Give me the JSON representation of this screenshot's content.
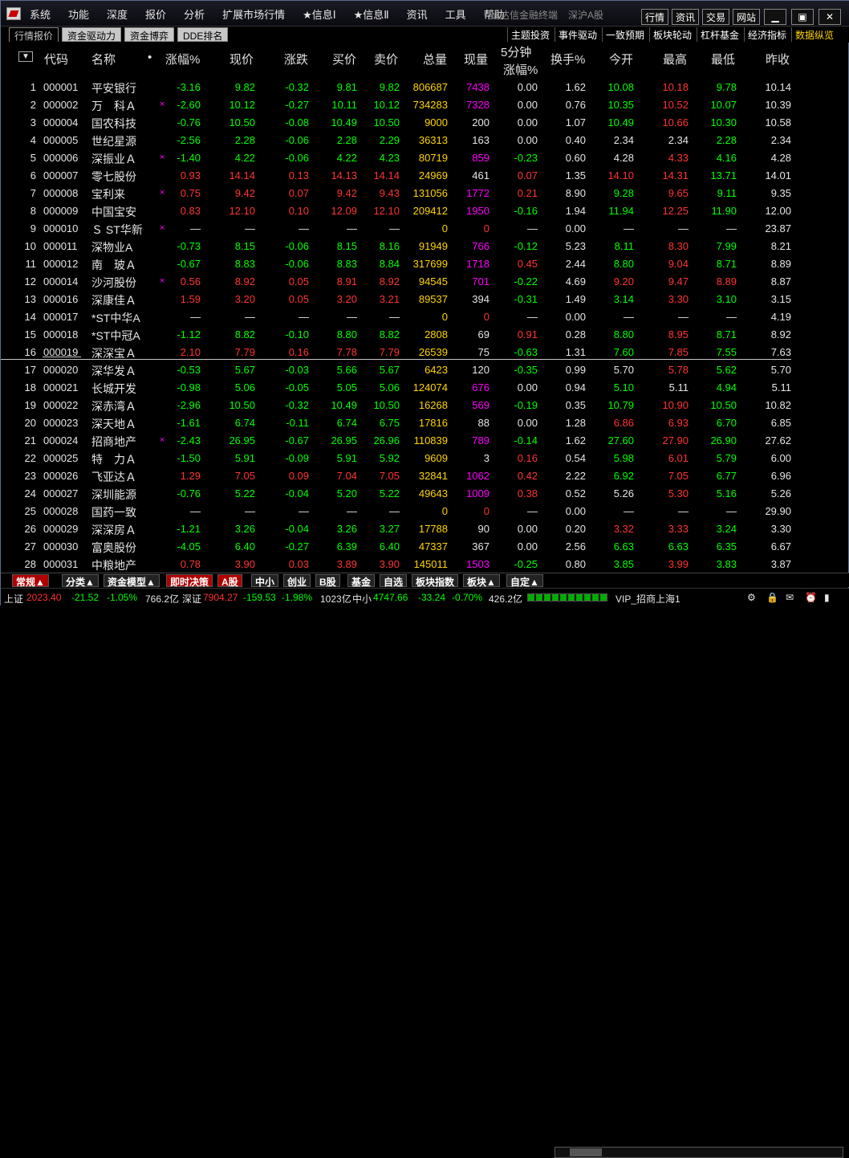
{
  "menu": [
    "系统",
    "功能",
    "深度",
    "报价",
    "分析",
    "扩展市场行情",
    "★信息Ⅰ",
    "★信息Ⅱ",
    "资讯",
    "工具",
    "帮助"
  ],
  "app_title": "通达信金融终端",
  "market_label": "深沪A股",
  "top_buttons": [
    "行情",
    "资讯",
    "交易",
    "网站"
  ],
  "window_buttons": [
    "minimize-icon",
    "restore-icon",
    "close-icon"
  ],
  "left_tabs": [
    "行情报价",
    "资金驱动力",
    "资金博弈",
    "DDE排名"
  ],
  "right_tabs": [
    "主题投资",
    "事件驱动",
    "一致预期",
    "板块轮动",
    "杠杆基金",
    "经济指标",
    "数据纵览"
  ],
  "headers": {
    "sort": "▼",
    "code": "代码",
    "name": "名称",
    "dot": "•",
    "pct": "涨幅%",
    "price": "现价",
    "chg": "涨跌",
    "bid": "买价",
    "ask": "卖价",
    "vol": "总量",
    "cur": "现量",
    "min5a": "5分钟",
    "min5b": "涨幅%",
    "turn": "换手%",
    "open": "今开",
    "high": "最高",
    "low": "最低",
    "prev": "昨收"
  },
  "rows": [
    {
      "no": "1",
      "code": "000001",
      "name": "平安银行",
      "mark": "",
      "pct": "-3.16",
      "price": "9.82",
      "chg": "-0.32",
      "bid": "9.81",
      "ask": "9.82",
      "vol": "806687",
      "cur": "7438",
      "m5": "0.00",
      "turn": "1.62",
      "open": "10.08",
      "high": "10.18",
      "low": "9.78",
      "prev": "10.14",
      "c": {
        "pct": "g",
        "price": "g",
        "chg": "g",
        "bid": "g",
        "ask": "g",
        "cur": "m",
        "m5": "w",
        "open": "g",
        "high": "rd",
        "low": "g"
      }
    },
    {
      "no": "2",
      "code": "000002",
      "name": "万　科Ａ",
      "mark": "×",
      "pct": "-2.60",
      "price": "10.12",
      "chg": "-0.27",
      "bid": "10.11",
      "ask": "10.12",
      "vol": "734283",
      "cur": "7328",
      "m5": "0.00",
      "turn": "0.76",
      "open": "10.35",
      "high": "10.52",
      "low": "10.07",
      "prev": "10.39",
      "c": {
        "pct": "g",
        "price": "g",
        "chg": "g",
        "bid": "g",
        "ask": "g",
        "cur": "m",
        "m5": "w",
        "open": "g",
        "high": "rd",
        "low": "g"
      }
    },
    {
      "no": "3",
      "code": "000004",
      "name": "国农科技",
      "mark": "",
      "pct": "-0.76",
      "price": "10.50",
      "chg": "-0.08",
      "bid": "10.49",
      "ask": "10.50",
      "vol": "9000",
      "cur": "200",
      "m5": "0.00",
      "turn": "1.07",
      "open": "10.49",
      "high": "10.66",
      "low": "10.30",
      "prev": "10.58",
      "c": {
        "pct": "g",
        "price": "g",
        "chg": "g",
        "bid": "g",
        "ask": "g",
        "cur": "w",
        "m5": "w",
        "open": "g",
        "high": "rd",
        "low": "g"
      }
    },
    {
      "no": "4",
      "code": "000005",
      "name": "世纪星源",
      "mark": "",
      "pct": "-2.56",
      "price": "2.28",
      "chg": "-0.06",
      "bid": "2.28",
      "ask": "2.29",
      "vol": "36313",
      "cur": "163",
      "m5": "0.00",
      "turn": "0.40",
      "open": "2.34",
      "high": "2.34",
      "low": "2.28",
      "prev": "2.34",
      "c": {
        "pct": "g",
        "price": "g",
        "chg": "g",
        "bid": "g",
        "ask": "g",
        "cur": "w",
        "m5": "w",
        "open": "w",
        "high": "w",
        "low": "g"
      }
    },
    {
      "no": "5",
      "code": "000006",
      "name": "深振业Ａ",
      "mark": "×",
      "pct": "-1.40",
      "price": "4.22",
      "chg": "-0.06",
      "bid": "4.22",
      "ask": "4.23",
      "vol": "80719",
      "cur": "859",
      "m5": "-0.23",
      "turn": "0.60",
      "open": "4.28",
      "high": "4.33",
      "low": "4.16",
      "prev": "4.28",
      "c": {
        "pct": "g",
        "price": "g",
        "chg": "g",
        "bid": "g",
        "ask": "g",
        "cur": "m",
        "m5": "g",
        "open": "w",
        "high": "rd",
        "low": "g"
      }
    },
    {
      "no": "6",
      "code": "000007",
      "name": "零七股份",
      "mark": "",
      "pct": "0.93",
      "price": "14.14",
      "chg": "0.13",
      "bid": "14.13",
      "ask": "14.14",
      "vol": "24969",
      "cur": "461",
      "m5": "0.07",
      "turn": "1.35",
      "open": "14.10",
      "high": "14.31",
      "low": "13.71",
      "prev": "14.01",
      "c": {
        "pct": "rd",
        "price": "rd",
        "chg": "rd",
        "bid": "rd",
        "ask": "rd",
        "cur": "w",
        "m5": "rd",
        "open": "rd",
        "high": "rd",
        "low": "g"
      }
    },
    {
      "no": "7",
      "code": "000008",
      "name": "宝利来",
      "mark": "×",
      "pct": "0.75",
      "price": "9.42",
      "chg": "0.07",
      "bid": "9.42",
      "ask": "9.43",
      "vol": "131056",
      "cur": "1772",
      "m5": "0.21",
      "turn": "8.90",
      "open": "9.28",
      "high": "9.65",
      "low": "9.11",
      "prev": "9.35",
      "c": {
        "pct": "rd",
        "price": "rd",
        "chg": "rd",
        "bid": "rd",
        "ask": "rd",
        "cur": "m",
        "m5": "rd",
        "open": "g",
        "high": "rd",
        "low": "g"
      }
    },
    {
      "no": "8",
      "code": "000009",
      "name": "中国宝安",
      "mark": "",
      "pct": "0.83",
      "price": "12.10",
      "chg": "0.10",
      "bid": "12.09",
      "ask": "12.10",
      "vol": "209412",
      "cur": "1950",
      "m5": "-0.16",
      "turn": "1.94",
      "open": "11.94",
      "high": "12.25",
      "low": "11.90",
      "prev": "12.00",
      "c": {
        "pct": "rd",
        "price": "rd",
        "chg": "rd",
        "bid": "rd",
        "ask": "rd",
        "cur": "m",
        "m5": "g",
        "open": "g",
        "high": "rd",
        "low": "g"
      }
    },
    {
      "no": "9",
      "code": "000010",
      "name": "Ｓ ST华新",
      "mark": "×",
      "pct": "—",
      "price": "—",
      "chg": "—",
      "bid": "—",
      "ask": "—",
      "vol": "0",
      "cur": "0",
      "m5": "—",
      "turn": "0.00",
      "open": "—",
      "high": "—",
      "low": "—",
      "prev": "23.87",
      "c": {
        "pct": "w",
        "price": "w",
        "chg": "w",
        "bid": "w",
        "ask": "w",
        "cur": "rd",
        "m5": "w",
        "open": "w",
        "high": "w",
        "low": "w"
      }
    },
    {
      "no": "10",
      "code": "000011",
      "name": "深物业A",
      "mark": "",
      "pct": "-0.73",
      "price": "8.15",
      "chg": "-0.06",
      "bid": "8.15",
      "ask": "8.16",
      "vol": "91949",
      "cur": "766",
      "m5": "-0.12",
      "turn": "5.23",
      "open": "8.11",
      "high": "8.30",
      "low": "7.99",
      "prev": "8.21",
      "c": {
        "pct": "g",
        "price": "g",
        "chg": "g",
        "bid": "g",
        "ask": "g",
        "cur": "m",
        "m5": "g",
        "open": "g",
        "high": "rd",
        "low": "g"
      }
    },
    {
      "no": "11",
      "code": "000012",
      "name": "南　玻Ａ",
      "mark": "",
      "pct": "-0.67",
      "price": "8.83",
      "chg": "-0.06",
      "bid": "8.83",
      "ask": "8.84",
      "vol": "317699",
      "cur": "1718",
      "m5": "0.45",
      "turn": "2.44",
      "open": "8.80",
      "high": "9.04",
      "low": "8.71",
      "prev": "8.89",
      "c": {
        "pct": "g",
        "price": "g",
        "chg": "g",
        "bid": "g",
        "ask": "g",
        "cur": "m",
        "m5": "rd",
        "open": "g",
        "high": "rd",
        "low": "g"
      }
    },
    {
      "no": "12",
      "code": "000014",
      "name": "沙河股份",
      "mark": "×",
      "pct": "0.56",
      "price": "8.92",
      "chg": "0.05",
      "bid": "8.91",
      "ask": "8.92",
      "vol": "94545",
      "cur": "701",
      "m5": "-0.22",
      "turn": "4.69",
      "open": "9.20",
      "high": "9.47",
      "low": "8.89",
      "prev": "8.87",
      "c": {
        "pct": "rd",
        "price": "rd",
        "chg": "rd",
        "bid": "rd",
        "ask": "rd",
        "cur": "m",
        "m5": "g",
        "open": "rd",
        "high": "rd",
        "low": "rd"
      }
    },
    {
      "no": "13",
      "code": "000016",
      "name": "深康佳Ａ",
      "mark": "",
      "pct": "1.59",
      "price": "3.20",
      "chg": "0.05",
      "bid": "3.20",
      "ask": "3.21",
      "vol": "89537",
      "cur": "394",
      "m5": "-0.31",
      "turn": "1.49",
      "open": "3.14",
      "high": "3.30",
      "low": "3.10",
      "prev": "3.15",
      "c": {
        "pct": "rd",
        "price": "rd",
        "chg": "rd",
        "bid": "rd",
        "ask": "rd",
        "cur": "w",
        "m5": "g",
        "open": "g",
        "high": "rd",
        "low": "g"
      }
    },
    {
      "no": "14",
      "code": "000017",
      "name": "*ST中华A",
      "mark": "",
      "pct": "—",
      "price": "—",
      "chg": "—",
      "bid": "—",
      "ask": "—",
      "vol": "0",
      "cur": "0",
      "m5": "—",
      "turn": "0.00",
      "open": "—",
      "high": "—",
      "low": "—",
      "prev": "4.19",
      "c": {
        "pct": "w",
        "price": "w",
        "chg": "w",
        "bid": "w",
        "ask": "w",
        "cur": "rd",
        "m5": "w",
        "open": "w",
        "high": "w",
        "low": "w"
      }
    },
    {
      "no": "15",
      "code": "000018",
      "name": "*ST中冠A",
      "mark": "",
      "pct": "-1.12",
      "price": "8.82",
      "chg": "-0.10",
      "bid": "8.80",
      "ask": "8.82",
      "vol": "2808",
      "cur": "69",
      "m5": "0.91",
      "turn": "0.28",
      "open": "8.80",
      "high": "8.95",
      "low": "8.71",
      "prev": "8.92",
      "c": {
        "pct": "g",
        "price": "g",
        "chg": "g",
        "bid": "g",
        "ask": "g",
        "cur": "w",
        "m5": "rd",
        "open": "g",
        "high": "rd",
        "low": "g"
      }
    },
    {
      "no": "16",
      "code": "000019",
      "name": "深深宝Ａ",
      "mark": "",
      "pct": "2.10",
      "price": "7.79",
      "chg": "0.16",
      "bid": "7.78",
      "ask": "7.79",
      "vol": "26539",
      "cur": "75",
      "m5": "-0.63",
      "turn": "1.31",
      "open": "7.60",
      "high": "7.85",
      "low": "7.55",
      "prev": "7.63",
      "c": {
        "pct": "rd",
        "price": "rd",
        "chg": "rd",
        "bid": "rd",
        "ask": "rd",
        "cur": "w",
        "m5": "g",
        "open": "g",
        "high": "rd",
        "low": "g"
      }
    },
    {
      "no": "17",
      "code": "000020",
      "name": "深华发Ａ",
      "mark": "",
      "pct": "-0.53",
      "price": "5.67",
      "chg": "-0.03",
      "bid": "5.66",
      "ask": "5.67",
      "vol": "6423",
      "cur": "120",
      "m5": "-0.35",
      "turn": "0.99",
      "open": "5.70",
      "high": "5.78",
      "low": "5.62",
      "prev": "5.70",
      "c": {
        "pct": "g",
        "price": "g",
        "chg": "g",
        "bid": "g",
        "ask": "g",
        "cur": "w",
        "m5": "g",
        "open": "w",
        "high": "rd",
        "low": "g"
      }
    },
    {
      "no": "18",
      "code": "000021",
      "name": "长城开发",
      "mark": "",
      "pct": "-0.98",
      "price": "5.06",
      "chg": "-0.05",
      "bid": "5.05",
      "ask": "5.06",
      "vol": "124074",
      "cur": "676",
      "m5": "0.00",
      "turn": "0.94",
      "open": "5.10",
      "high": "5.11",
      "low": "4.94",
      "prev": "5.11",
      "c": {
        "pct": "g",
        "price": "g",
        "chg": "g",
        "bid": "g",
        "ask": "g",
        "cur": "m",
        "m5": "w",
        "open": "g",
        "high": "w",
        "low": "g"
      }
    },
    {
      "no": "19",
      "code": "000022",
      "name": "深赤湾Ａ",
      "mark": "",
      "pct": "-2.96",
      "price": "10.50",
      "chg": "-0.32",
      "bid": "10.49",
      "ask": "10.50",
      "vol": "16268",
      "cur": "569",
      "m5": "-0.19",
      "turn": "0.35",
      "open": "10.79",
      "high": "10.90",
      "low": "10.50",
      "prev": "10.82",
      "c": {
        "pct": "g",
        "price": "g",
        "chg": "g",
        "bid": "g",
        "ask": "g",
        "cur": "m",
        "m5": "g",
        "open": "g",
        "high": "rd",
        "low": "g"
      }
    },
    {
      "no": "20",
      "code": "000023",
      "name": "深天地Ａ",
      "mark": "",
      "pct": "-1.61",
      "price": "6.74",
      "chg": "-0.11",
      "bid": "6.74",
      "ask": "6.75",
      "vol": "17816",
      "cur": "88",
      "m5": "0.00",
      "turn": "1.28",
      "open": "6.86",
      "high": "6.93",
      "low": "6.70",
      "prev": "6.85",
      "c": {
        "pct": "g",
        "price": "g",
        "chg": "g",
        "bid": "g",
        "ask": "g",
        "cur": "w",
        "m5": "w",
        "open": "rd",
        "high": "rd",
        "low": "g"
      }
    },
    {
      "no": "21",
      "code": "000024",
      "name": "招商地产",
      "mark": "×",
      "pct": "-2.43",
      "price": "26.95",
      "chg": "-0.67",
      "bid": "26.95",
      "ask": "26.96",
      "vol": "110839",
      "cur": "789",
      "m5": "-0.14",
      "turn": "1.62",
      "open": "27.60",
      "high": "27.90",
      "low": "26.90",
      "prev": "27.62",
      "c": {
        "pct": "g",
        "price": "g",
        "chg": "g",
        "bid": "g",
        "ask": "g",
        "cur": "m",
        "m5": "g",
        "open": "g",
        "high": "rd",
        "low": "g"
      }
    },
    {
      "no": "22",
      "code": "000025",
      "name": "特　力Ａ",
      "mark": "",
      "pct": "-1.50",
      "price": "5.91",
      "chg": "-0.09",
      "bid": "5.91",
      "ask": "5.92",
      "vol": "9609",
      "cur": "3",
      "m5": "0.16",
      "turn": "0.54",
      "open": "5.98",
      "high": "6.01",
      "low": "5.79",
      "prev": "6.00",
      "c": {
        "pct": "g",
        "price": "g",
        "chg": "g",
        "bid": "g",
        "ask": "g",
        "cur": "w",
        "m5": "rd",
        "open": "g",
        "high": "rd",
        "low": "g"
      }
    },
    {
      "no": "23",
      "code": "000026",
      "name": "飞亚达Ａ",
      "mark": "",
      "pct": "1.29",
      "price": "7.05",
      "chg": "0.09",
      "bid": "7.04",
      "ask": "7.05",
      "vol": "32841",
      "cur": "1062",
      "m5": "0.42",
      "turn": "2.22",
      "open": "6.92",
      "high": "7.05",
      "low": "6.77",
      "prev": "6.96",
      "c": {
        "pct": "rd",
        "price": "rd",
        "chg": "rd",
        "bid": "rd",
        "ask": "rd",
        "cur": "m",
        "m5": "rd",
        "open": "g",
        "high": "rd",
        "low": "g"
      }
    },
    {
      "no": "24",
      "code": "000027",
      "name": "深圳能源",
      "mark": "",
      "pct": "-0.76",
      "price": "5.22",
      "chg": "-0.04",
      "bid": "5.20",
      "ask": "5.22",
      "vol": "49643",
      "cur": "1009",
      "m5": "0.38",
      "turn": "0.52",
      "open": "5.26",
      "high": "5.30",
      "low": "5.16",
      "prev": "5.26",
      "c": {
        "pct": "g",
        "price": "g",
        "chg": "g",
        "bid": "g",
        "ask": "g",
        "cur": "m",
        "m5": "rd",
        "open": "w",
        "high": "rd",
        "low": "g"
      }
    },
    {
      "no": "25",
      "code": "000028",
      "name": "国药一致",
      "mark": "",
      "pct": "—",
      "price": "—",
      "chg": "—",
      "bid": "—",
      "ask": "—",
      "vol": "0",
      "cur": "0",
      "m5": "—",
      "turn": "0.00",
      "open": "—",
      "high": "—",
      "low": "—",
      "prev": "29.90",
      "c": {
        "pct": "w",
        "price": "w",
        "chg": "w",
        "bid": "w",
        "ask": "w",
        "cur": "rd",
        "m5": "w",
        "open": "w",
        "high": "w",
        "low": "w"
      }
    },
    {
      "no": "26",
      "code": "000029",
      "name": "深深房Ａ",
      "mark": "",
      "pct": "-1.21",
      "price": "3.26",
      "chg": "-0.04",
      "bid": "3.26",
      "ask": "3.27",
      "vol": "17788",
      "cur": "90",
      "m5": "0.00",
      "turn": "0.20",
      "open": "3.32",
      "high": "3.33",
      "low": "3.24",
      "prev": "3.30",
      "c": {
        "pct": "g",
        "price": "g",
        "chg": "g",
        "bid": "g",
        "ask": "g",
        "cur": "w",
        "m5": "w",
        "open": "rd",
        "high": "rd",
        "low": "g"
      }
    },
    {
      "no": "27",
      "code": "000030",
      "name": "富奥股份",
      "mark": "",
      "pct": "-4.05",
      "price": "6.40",
      "chg": "-0.27",
      "bid": "6.39",
      "ask": "6.40",
      "vol": "47337",
      "cur": "367",
      "m5": "0.00",
      "turn": "2.56",
      "open": "6.63",
      "high": "6.63",
      "low": "6.35",
      "prev": "6.67",
      "c": {
        "pct": "g",
        "price": "g",
        "chg": "g",
        "bid": "g",
        "ask": "g",
        "cur": "w",
        "m5": "w",
        "open": "g",
        "high": "g",
        "low": "g"
      }
    },
    {
      "no": "28",
      "code": "000031",
      "name": "中粮地产",
      "mark": "",
      "pct": "0.78",
      "price": "3.90",
      "chg": "0.03",
      "bid": "3.89",
      "ask": "3.90",
      "vol": "145011",
      "cur": "1503",
      "m5": "-0.25",
      "turn": "0.80",
      "open": "3.85",
      "high": "3.99",
      "low": "3.83",
      "prev": "3.87",
      "c": {
        "pct": "rd",
        "price": "rd",
        "chg": "rd",
        "bid": "rd",
        "ask": "rd",
        "cur": "m",
        "m5": "g",
        "open": "g",
        "high": "rd",
        "low": "g"
      }
    }
  ],
  "bottom_tabs": [
    "常规▲",
    "分类▲",
    "资金模型▲",
    "即时决策",
    "A股",
    "中小",
    "创业",
    "B股",
    "基金",
    "自选",
    "板块指数",
    "板块▲",
    "自定▲"
  ],
  "status": {
    "sh_label": "上证",
    "sh_val": "2023.40",
    "sh_chg": "-21.52",
    "sh_pct": "-1.05%",
    "sh_amt": "766.2亿",
    "sz_label": "深证",
    "sz_val": "7904.27",
    "sz_chg": "-159.53",
    "sz_pct": "-1.98%",
    "sz_amt": "1023亿",
    "zx_label": "中小",
    "zx_val": "4747.66",
    "zx_chg": "-33.24",
    "zx_pct": "-0.70%",
    "zx_amt": "426.2亿",
    "vip": "VIP_招商上海1"
  }
}
